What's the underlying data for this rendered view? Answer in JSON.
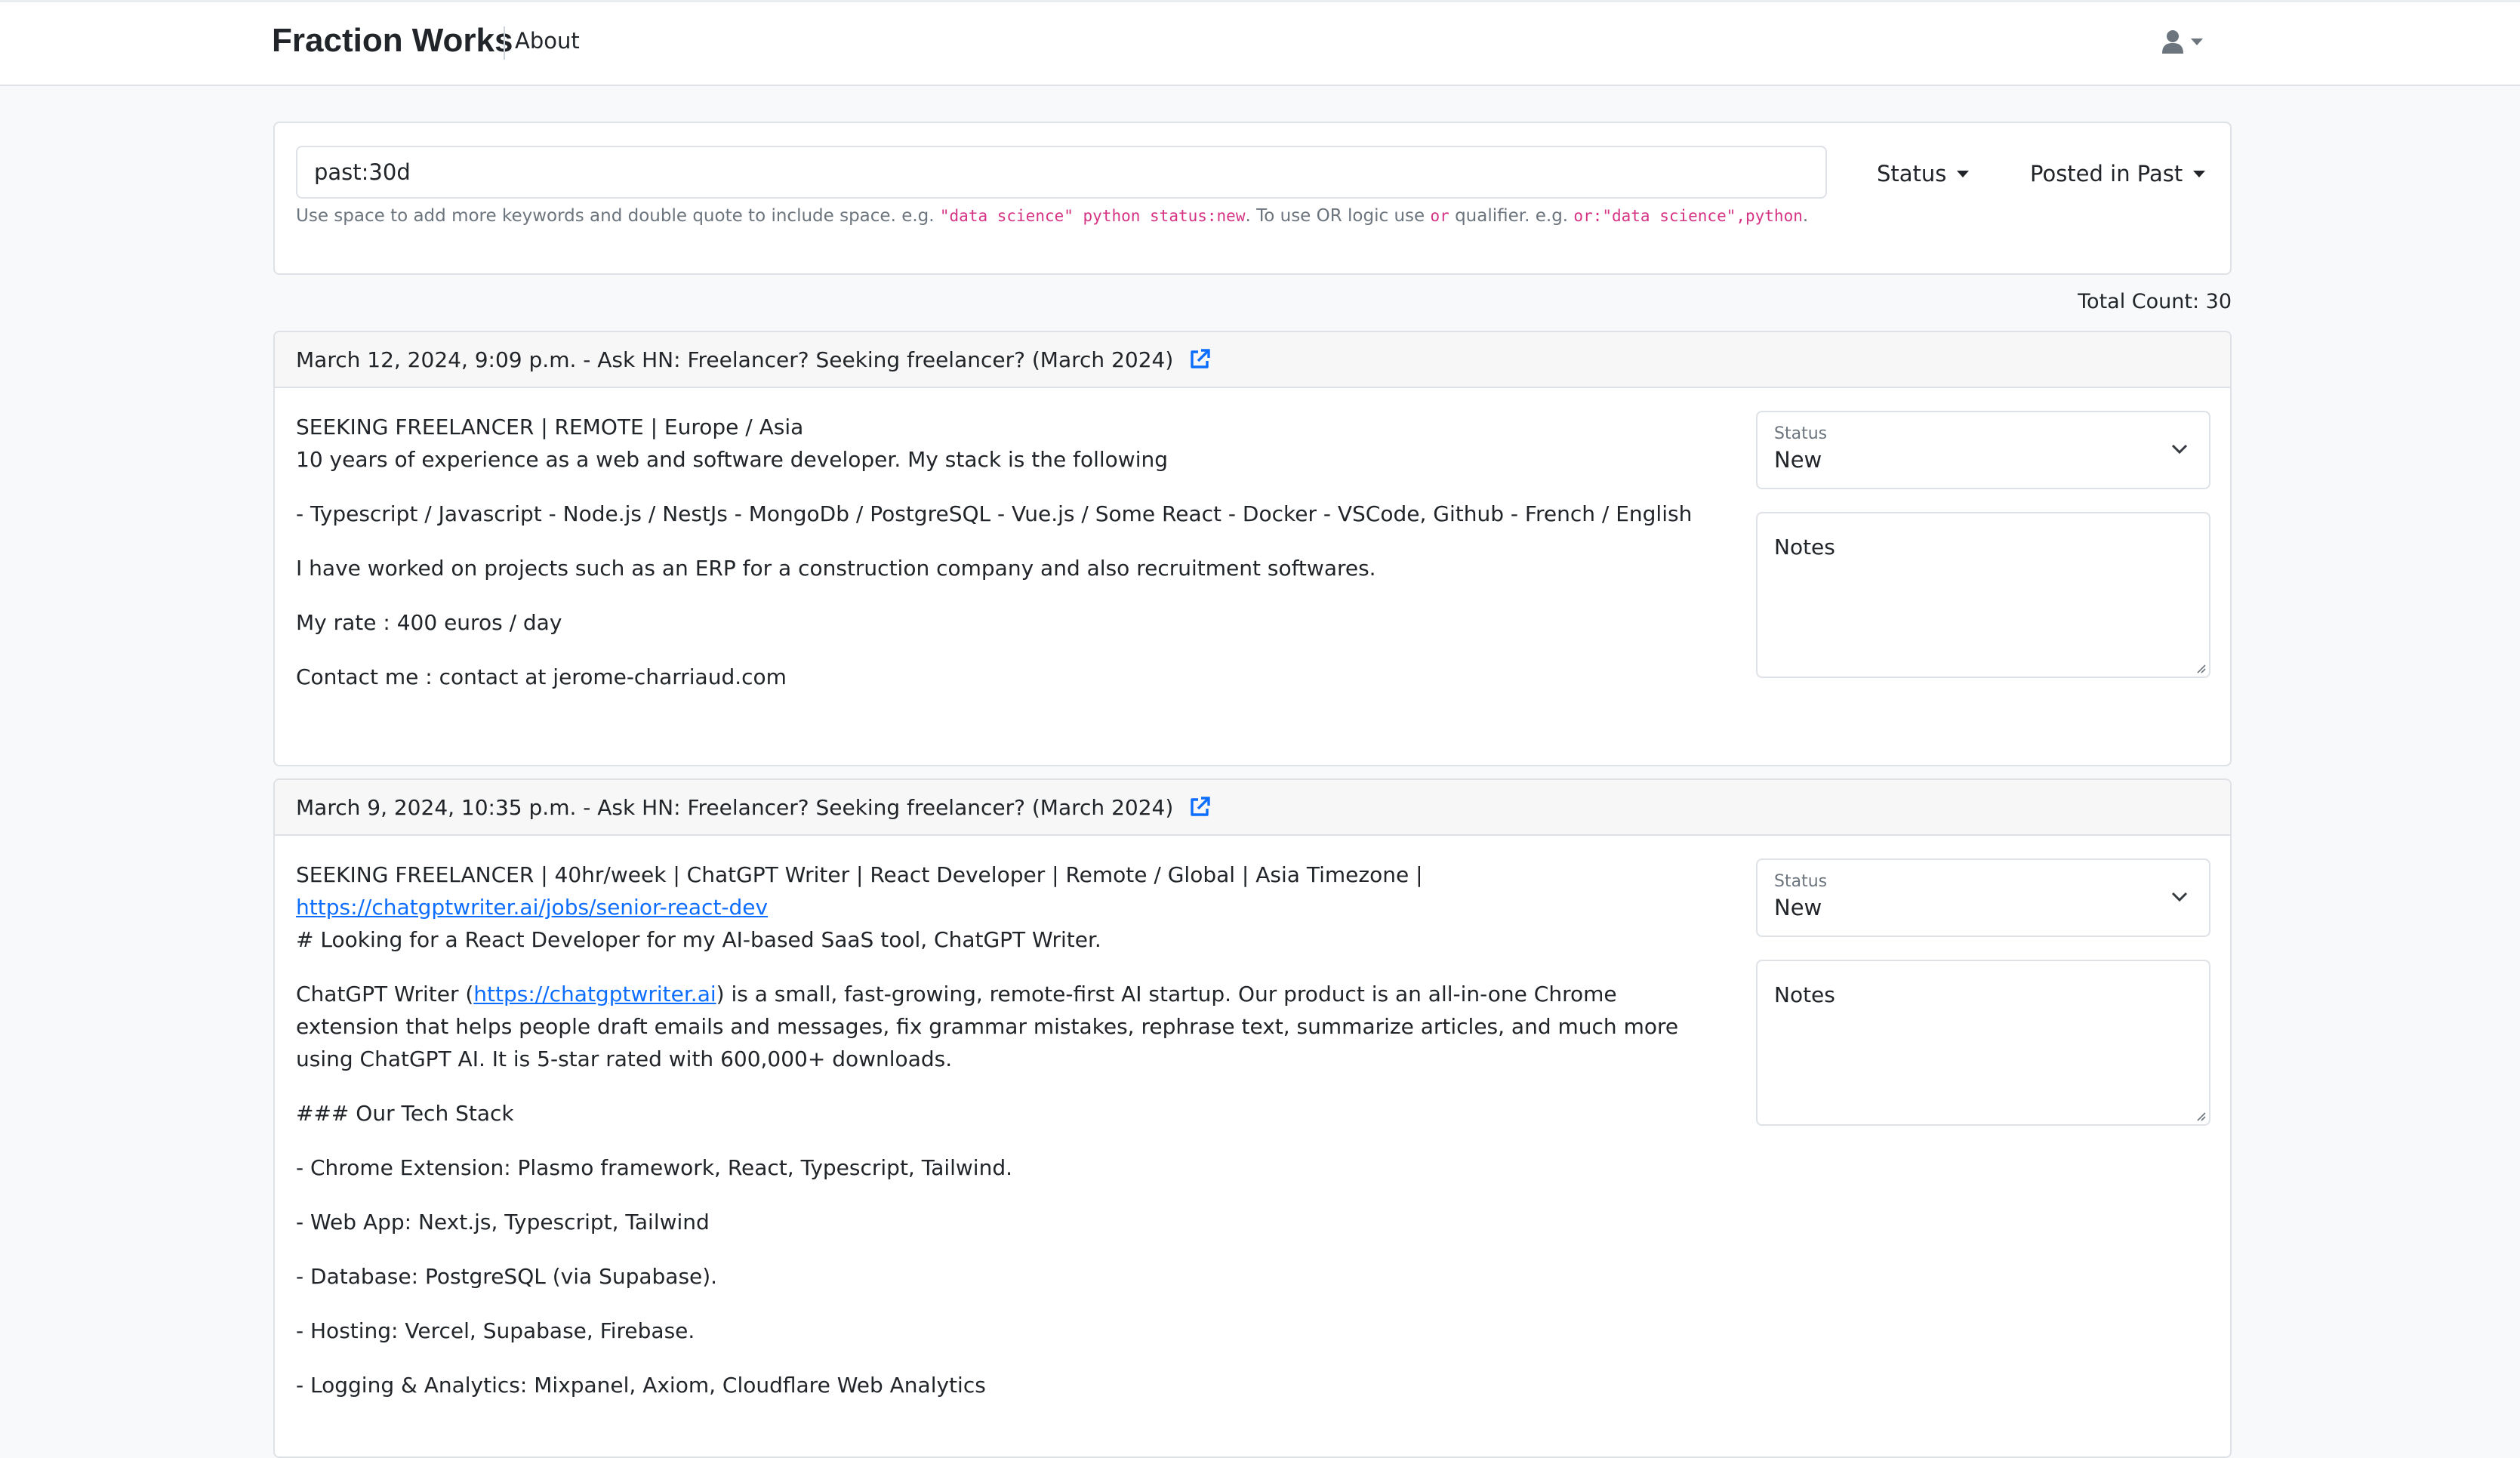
{
  "navbar": {
    "brand": "Fraction Works",
    "about": "About"
  },
  "filters": {
    "search_value": "past:30d",
    "status_label": "Status",
    "posted_label": "Posted in Past",
    "help": {
      "t1": "Use space to add more keywords and double quote to include space. e.g. ",
      "c1": "\"data science\" python status:new",
      "t2": ". To use OR logic use ",
      "c2": "or",
      "t3": " qualifier. e.g. ",
      "c3": "or:\"data science\",python",
      "t4": "."
    }
  },
  "results": {
    "total": "Total Count: 30"
  },
  "posts": [
    {
      "header": "March 12, 2024, 9:09 p.m. - Ask HN: Freelancer? Seeking freelancer? (March 2024)",
      "status_label": "Status",
      "status_value": "New",
      "notes": "Notes",
      "lines": [
        "SEEKING FREELANCER | REMOTE | Europe / Asia",
        "10 years of experience as a web and software developer. My stack is the following",
        "- Typescript / Javascript - Node.js / NestJs - MongoDb / PostgreSQL - Vue.js / Some React - Docker - VSCode, Github - French / English",
        "I have worked on projects such as an ERP for a construction company and also recruitment softwares.",
        "My rate : 400 euros / day",
        "Contact me : contact at jerome-charriaud.com"
      ]
    },
    {
      "header": "March 9, 2024, 10:35 p.m. - Ask HN: Freelancer? Seeking freelancer? (March 2024)",
      "status_label": "Status",
      "status_value": "New",
      "notes": "Notes",
      "intro": "SEEKING FREELANCER | 40hr/week | ChatGPT Writer | React Developer | Remote / Global | Asia Timezone | ",
      "intro_link": "https://chatgptwriter.ai/jobs/senior-react-dev",
      "heading": "# Looking for a React Developer for my AI-based SaaS tool, ChatGPT Writer.",
      "para_a": "ChatGPT Writer (",
      "para_link": "https://chatgptwriter.ai",
      "para_b": ") is a small, fast-growing, remote-first AI startup. Our product is an all-in-one Chrome extension that helps people draft emails and messages, fix grammar mistakes, rephrase text, summarize articles, and much more using ChatGPT AI. It is 5-star rated with 600,000+ downloads.",
      "stack_heading": "### Our Tech Stack",
      "stack": [
        "- Chrome Extension: Plasmo framework, React, Typescript, Tailwind.",
        "- Web App: Next.js, Typescript, Tailwind",
        "- Database: PostgreSQL (via Supabase).",
        "- Hosting: Vercel, Supabase, Firebase.",
        "- Logging & Analytics: Mixpanel, Axiom, Cloudflare Web Analytics"
      ]
    }
  ]
}
